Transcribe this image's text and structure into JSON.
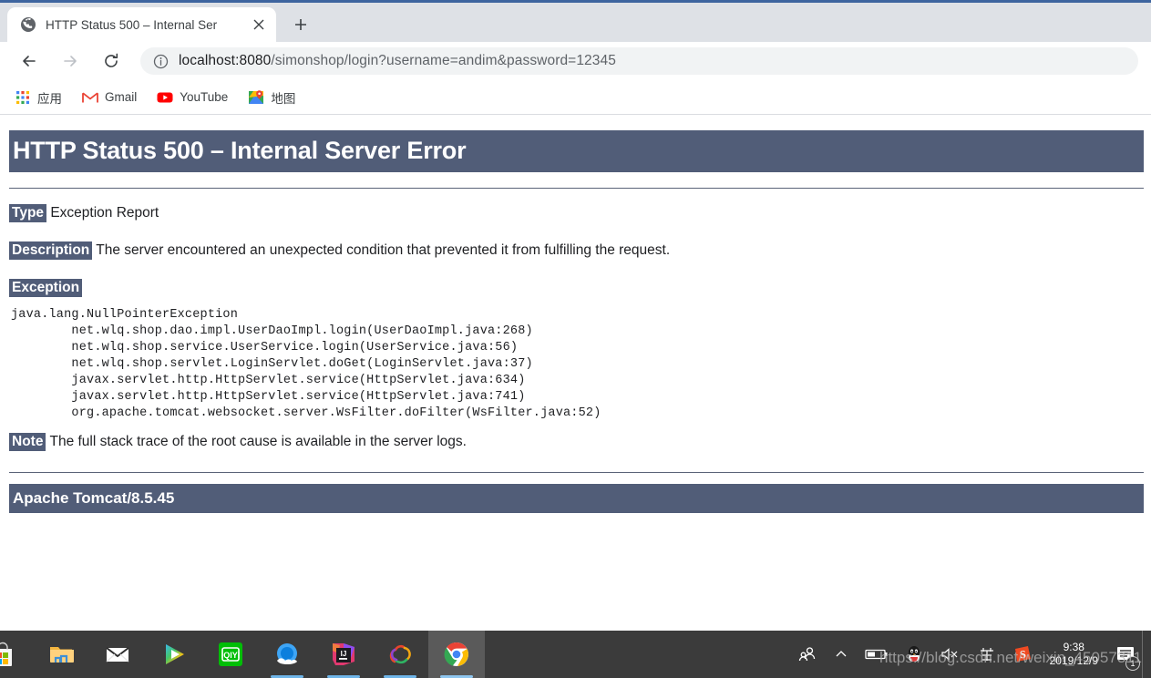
{
  "browser": {
    "tab": {
      "title": "HTTP Status 500 – Internal Ser",
      "favicon_name": "globe-favicon",
      "close_label": "✕",
      "newtab_label": "+"
    },
    "toolbar": {
      "back_label": "←",
      "forward_label": "→",
      "reload_label": "⟳",
      "url_host": "localhost:8080",
      "url_path": "/simonshop/login?username=andim&password=12345",
      "url_full": "localhost:8080/simonshop/login?username=andim&password=12345",
      "info_icon_name": "page-info-icon"
    },
    "bookmarks": [
      {
        "label": "应用",
        "icon": "apps-grid-icon"
      },
      {
        "label": "Gmail",
        "icon": "gmail-icon"
      },
      {
        "label": "YouTube",
        "icon": "youtube-icon"
      },
      {
        "label": "地图",
        "icon": "google-maps-icon"
      }
    ]
  },
  "page": {
    "title_banner": "HTTP Status 500 – Internal Server Error",
    "type_label": "Type",
    "type_value": "Exception Report",
    "description_label": "Description",
    "description_value": "The server encountered an unexpected condition that prevented it from fulfilling the request.",
    "exception_label": "Exception",
    "stack_trace": "java.lang.NullPointerException\n\tnet.wlq.shop.dao.impl.UserDaoImpl.login(UserDaoImpl.java:268)\n\tnet.wlq.shop.service.UserService.login(UserService.java:56)\n\tnet.wlq.shop.servlet.LoginServlet.doGet(LoginServlet.java:37)\n\tjavax.servlet.http.HttpServlet.service(HttpServlet.java:634)\n\tjavax.servlet.http.HttpServlet.service(HttpServlet.java:741)\n\torg.apache.tomcat.websocket.server.WsFilter.doFilter(WsFilter.java:52)",
    "note_label": "Note",
    "note_value": "The full stack trace of the root cause is available in the server logs.",
    "footer_banner": "Apache Tomcat/8.5.45",
    "accent_color": "#515D78"
  },
  "taskbar": {
    "apps": [
      {
        "name": "microsoft-store",
        "running": false
      },
      {
        "name": "file-explorer",
        "running": false
      },
      {
        "name": "mail",
        "running": false
      },
      {
        "name": "media-player",
        "running": false
      },
      {
        "name": "iqiyi",
        "running": false
      },
      {
        "name": "qq-browser",
        "running": true
      },
      {
        "name": "intellij-idea",
        "running": true
      },
      {
        "name": "navicat",
        "running": true
      },
      {
        "name": "google-chrome",
        "running": true,
        "active": true
      }
    ],
    "tray": {
      "people_icon": "people-icon",
      "chevron_icon": "chevron-up-icon",
      "battery_icon": "battery-icon",
      "qq_icon": "qq-penguin-icon",
      "volume_icon": "volume-muted-icon",
      "ime_icon": "ime-chinese-icon",
      "sogou_icon": "sogou-input-icon",
      "time": "9:38",
      "date": "2019/12/9",
      "notification_icon": "action-center-icon",
      "notification_count": "1"
    }
  },
  "watermark": "https://blog.csdn.net/weixin_45057311"
}
